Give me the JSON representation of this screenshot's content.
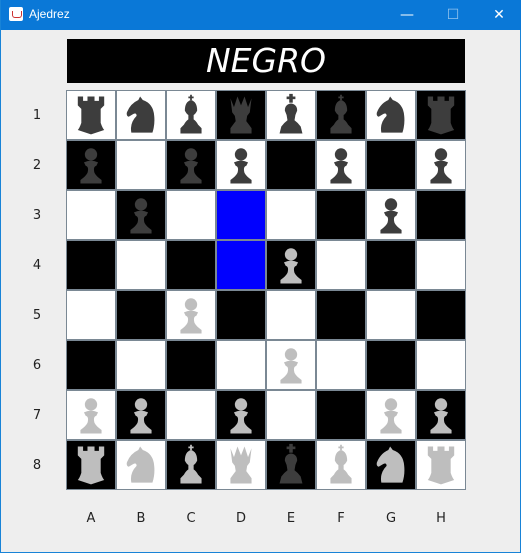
{
  "window": {
    "title": "Ajedrez",
    "minimize_glyph": "—",
    "maximize_glyph": "☐",
    "close_glyph": "✕"
  },
  "banner": {
    "text": "NEGRO"
  },
  "colors": {
    "light_square": "#ffffff",
    "dark_square": "#000000",
    "highlight": "#0000ff",
    "dark_piece": "#3d3d3d",
    "light_piece": "#bebebe"
  },
  "board": {
    "row_labels": [
      "1",
      "2",
      "3",
      "4",
      "5",
      "6",
      "7",
      "8"
    ],
    "col_labels": [
      "A",
      "B",
      "C",
      "D",
      "E",
      "F",
      "G",
      "H"
    ],
    "highlighted": [
      "D3",
      "D4"
    ],
    "squares": [
      [
        {
          "bg": "light",
          "piece": "rook-icon",
          "side": "dark"
        },
        {
          "bg": "light",
          "piece": "knight-icon",
          "side": "dark"
        },
        {
          "bg": "light",
          "piece": "bishop-icon",
          "side": "dark"
        },
        {
          "bg": "dark",
          "piece": "queen-icon",
          "side": "dark"
        },
        {
          "bg": "light",
          "piece": "king-icon",
          "side": "dark"
        },
        {
          "bg": "dark",
          "piece": "bishop-icon",
          "side": "dark"
        },
        {
          "bg": "light",
          "piece": "knight-icon",
          "side": "dark"
        },
        {
          "bg": "dark",
          "piece": "rook-icon",
          "side": "dark"
        }
      ],
      [
        {
          "bg": "dark",
          "piece": "pawn-icon",
          "side": "dark"
        },
        {
          "bg": "light",
          "piece": null,
          "side": null
        },
        {
          "bg": "dark",
          "piece": "pawn-icon",
          "side": "dark"
        },
        {
          "bg": "light",
          "piece": "pawn-icon",
          "side": "dark"
        },
        {
          "bg": "dark",
          "piece": null,
          "side": null
        },
        {
          "bg": "light",
          "piece": "pawn-icon",
          "side": "dark"
        },
        {
          "bg": "dark",
          "piece": null,
          "side": null
        },
        {
          "bg": "light",
          "piece": "pawn-icon",
          "side": "dark"
        }
      ],
      [
        {
          "bg": "light",
          "piece": null,
          "side": null
        },
        {
          "bg": "dark",
          "piece": "pawn-icon",
          "side": "dark"
        },
        {
          "bg": "light",
          "piece": null,
          "side": null
        },
        {
          "bg": "highlight",
          "piece": null,
          "side": null
        },
        {
          "bg": "light",
          "piece": null,
          "side": null
        },
        {
          "bg": "dark",
          "piece": null,
          "side": null
        },
        {
          "bg": "light",
          "piece": "pawn-icon",
          "side": "dark"
        },
        {
          "bg": "dark",
          "piece": null,
          "side": null
        }
      ],
      [
        {
          "bg": "dark",
          "piece": null,
          "side": null
        },
        {
          "bg": "light",
          "piece": null,
          "side": null
        },
        {
          "bg": "dark",
          "piece": null,
          "side": null
        },
        {
          "bg": "highlight",
          "piece": null,
          "side": null
        },
        {
          "bg": "dark",
          "piece": "pawn-icon",
          "side": "light"
        },
        {
          "bg": "light",
          "piece": null,
          "side": null
        },
        {
          "bg": "dark",
          "piece": null,
          "side": null
        },
        {
          "bg": "light",
          "piece": null,
          "side": null
        }
      ],
      [
        {
          "bg": "light",
          "piece": null,
          "side": null
        },
        {
          "bg": "dark",
          "piece": null,
          "side": null
        },
        {
          "bg": "light",
          "piece": "pawn-icon",
          "side": "light"
        },
        {
          "bg": "dark",
          "piece": null,
          "side": null
        },
        {
          "bg": "light",
          "piece": null,
          "side": null
        },
        {
          "bg": "dark",
          "piece": null,
          "side": null
        },
        {
          "bg": "light",
          "piece": null,
          "side": null
        },
        {
          "bg": "dark",
          "piece": null,
          "side": null
        }
      ],
      [
        {
          "bg": "dark",
          "piece": null,
          "side": null
        },
        {
          "bg": "light",
          "piece": null,
          "side": null
        },
        {
          "bg": "dark",
          "piece": null,
          "side": null
        },
        {
          "bg": "light",
          "piece": null,
          "side": null
        },
        {
          "bg": "light",
          "piece": "pawn-icon",
          "side": "light"
        },
        {
          "bg": "light",
          "piece": null,
          "side": null
        },
        {
          "bg": "dark",
          "piece": null,
          "side": null
        },
        {
          "bg": "light",
          "piece": null,
          "side": null
        }
      ],
      [
        {
          "bg": "light",
          "piece": "pawn-icon",
          "side": "light"
        },
        {
          "bg": "dark",
          "piece": "pawn-icon",
          "side": "light"
        },
        {
          "bg": "light",
          "piece": null,
          "side": null
        },
        {
          "bg": "dark",
          "piece": "pawn-icon",
          "side": "light"
        },
        {
          "bg": "light",
          "piece": null,
          "side": null
        },
        {
          "bg": "dark",
          "piece": null,
          "side": null
        },
        {
          "bg": "light",
          "piece": "pawn-icon",
          "side": "light"
        },
        {
          "bg": "dark",
          "piece": "pawn-icon",
          "side": "light"
        }
      ],
      [
        {
          "bg": "dark",
          "piece": "rook-icon",
          "side": "light"
        },
        {
          "bg": "light",
          "piece": "knight-icon",
          "side": "light"
        },
        {
          "bg": "dark",
          "piece": "bishop-icon",
          "side": "light"
        },
        {
          "bg": "light",
          "piece": "queen-icon",
          "side": "light"
        },
        {
          "bg": "dark",
          "piece": "king-icon",
          "side": "dark"
        },
        {
          "bg": "light",
          "piece": "bishop-icon",
          "side": "light"
        },
        {
          "bg": "dark",
          "piece": "knight-icon",
          "side": "light"
        },
        {
          "bg": "light",
          "piece": "rook-icon",
          "side": "light"
        }
      ]
    ]
  }
}
